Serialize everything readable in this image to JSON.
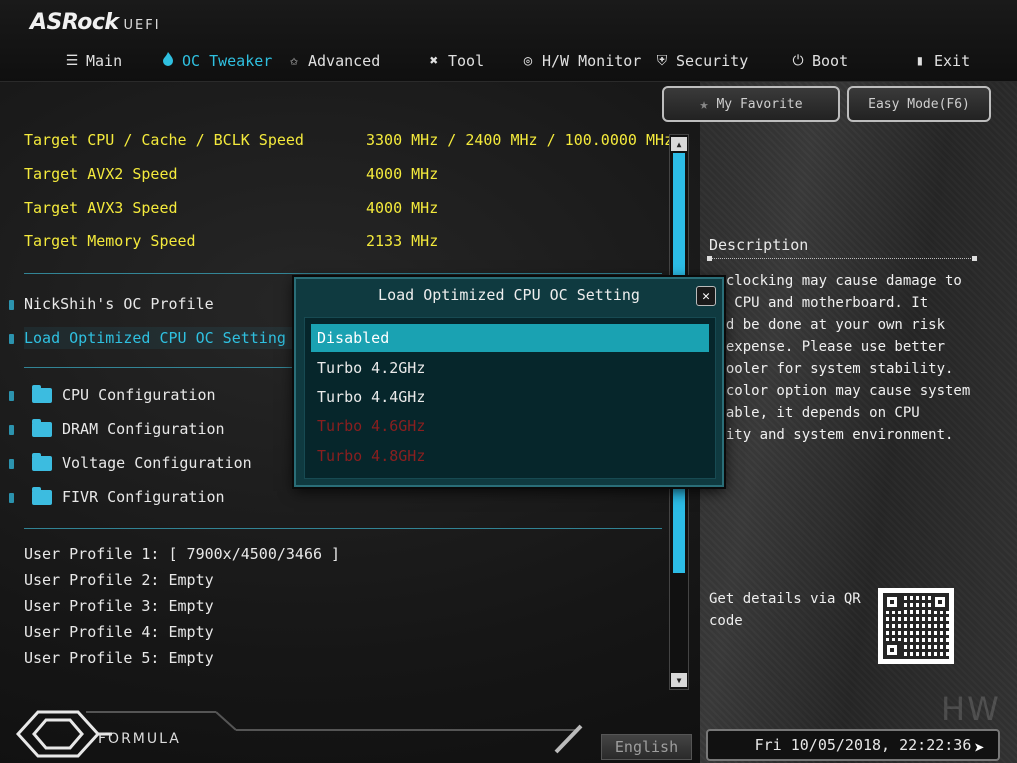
{
  "header": {
    "brand": "ASRock",
    "brand_suffix": "UEFI",
    "tabs": [
      {
        "label": "Main",
        "icon": "list-icon"
      },
      {
        "label": "OC Tweaker",
        "icon": "flame-icon",
        "active": true
      },
      {
        "label": "Advanced",
        "icon": "star-outline-icon"
      },
      {
        "label": "Tool",
        "icon": "tools-icon"
      },
      {
        "label": "H/W Monitor",
        "icon": "monitor-gauge-icon"
      },
      {
        "label": "Security",
        "icon": "shield-icon"
      },
      {
        "label": "Boot",
        "icon": "power-icon"
      },
      {
        "label": "Exit",
        "icon": "exit-door-icon"
      }
    ]
  },
  "toolbar": {
    "favorite_label": "My Favorite",
    "easy_mode_label": "Easy Mode(F6)"
  },
  "targets": [
    {
      "label": "Target CPU / Cache / BCLK Speed",
      "value": "3300 MHz / 2400 MHz / 100.0000 MHz"
    },
    {
      "label": "Target AVX2 Speed",
      "value": "4000 MHz"
    },
    {
      "label": "Target AVX3 Speed",
      "value": "4000 MHz"
    },
    {
      "label": "Target Memory Speed",
      "value": "2133 MHz"
    }
  ],
  "settings": {
    "oc_profile_label": "NickShih's OC Profile",
    "load_optimized_label": "Load Optimized CPU OC Setting",
    "hidden_value": "Disabled"
  },
  "submenus": [
    {
      "label": "CPU Configuration"
    },
    {
      "label": "DRAM Configuration"
    },
    {
      "label": "Voltage Configuration"
    },
    {
      "label": "FIVR Configuration"
    }
  ],
  "profiles": [
    "User Profile 1: [ 7900x/4500/3466 ]",
    "User Profile 2: Empty",
    "User Profile 3: Empty",
    "User Profile 4: Empty",
    "User Profile 5: Empty"
  ],
  "description": {
    "title": "Description",
    "text": "erclocking may cause damage to\nur CPU and motherboard. It\nuld be done at your own risk\nd expense. Please use better\n cooler for system stability.\nd color option may cause system\nstable, it depends on CPU\nality and system environment."
  },
  "qr": {
    "label": "Get details via QR code"
  },
  "footer": {
    "formula_label": "FORMULA",
    "language": "English",
    "datetime": "Fri 10/05/2018, 22:22:36",
    "watermark": "HW"
  },
  "modal": {
    "title": "Load Optimized CPU OC Setting",
    "close_glyph": "✕",
    "options": [
      {
        "label": "Disabled",
        "state": "selected"
      },
      {
        "label": "Turbo 4.2GHz",
        "state": "normal"
      },
      {
        "label": "Turbo 4.4GHz",
        "state": "normal"
      },
      {
        "label": "Turbo 4.6GHz",
        "state": "unavailable"
      },
      {
        "label": "Turbo 4.8GHz",
        "state": "unavailable"
      }
    ]
  },
  "colors": {
    "accent": "#2fc0e0",
    "target_text": "#f4ea3c",
    "modal_bg": "#0f3a40",
    "modal_selected": "#1aa2b2",
    "unavailable_text": "#8a1f1f"
  }
}
